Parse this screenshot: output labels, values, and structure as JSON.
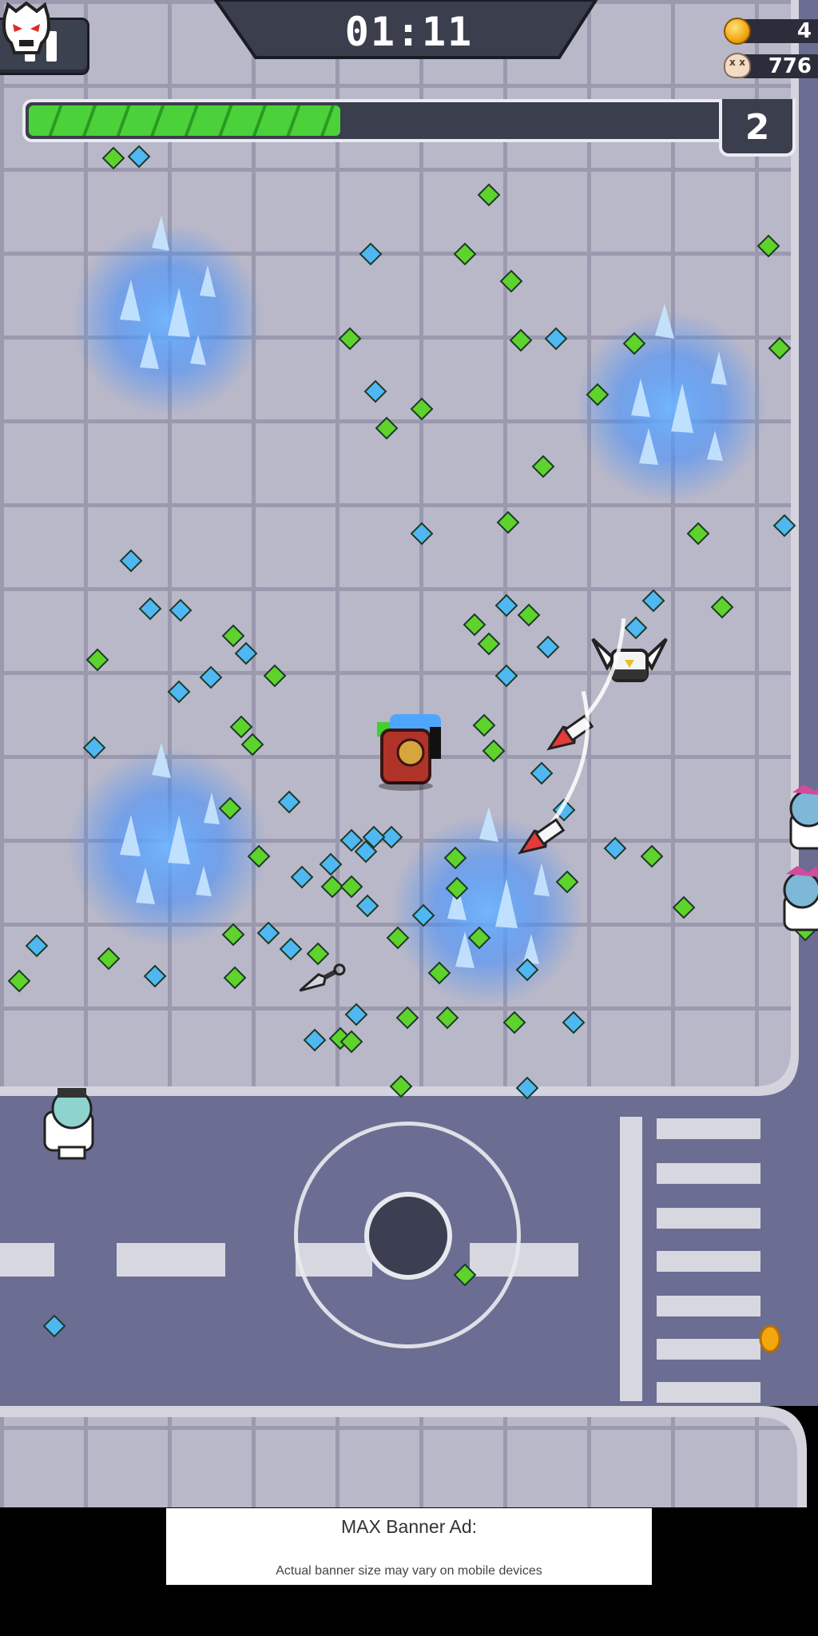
{
  "hud": {
    "timer": "01:11",
    "coins": "4",
    "kills": "776",
    "level": "2",
    "xp_progress": 0.41,
    "pause_icon": "pause-icon",
    "coin_icon": "coin-icon",
    "skull_icon": "skull-icon",
    "boss_icon": "boss-skull-icon"
  },
  "ad": {
    "title": "MAX Banner Ad:",
    "subtitle": "Actual banner size may vary on mobile devices"
  },
  "colors": {
    "floor": "#b8b7c6",
    "floor_line": "#8f8ea2",
    "road": "#6a6c90",
    "gem_green": "#5ed32b",
    "gem_blue": "#4fb8f2",
    "flame": "#5aa8ff",
    "hud_dark": "#2b2e3a"
  }
}
